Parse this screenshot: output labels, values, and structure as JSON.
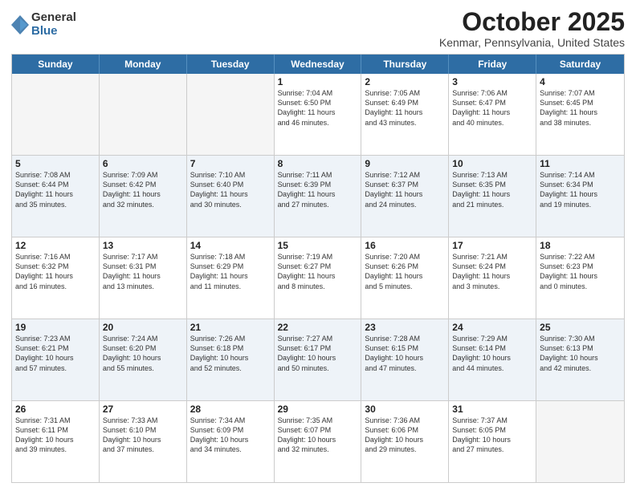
{
  "logo": {
    "general": "General",
    "blue": "Blue"
  },
  "header": {
    "month": "October 2025",
    "location": "Kenmar, Pennsylvania, United States"
  },
  "weekdays": [
    "Sunday",
    "Monday",
    "Tuesday",
    "Wednesday",
    "Thursday",
    "Friday",
    "Saturday"
  ],
  "rows": [
    [
      {
        "day": "",
        "info": "",
        "empty": true
      },
      {
        "day": "",
        "info": "",
        "empty": true
      },
      {
        "day": "",
        "info": "",
        "empty": true
      },
      {
        "day": "1",
        "info": "Sunrise: 7:04 AM\nSunset: 6:50 PM\nDaylight: 11 hours\nand 46 minutes."
      },
      {
        "day": "2",
        "info": "Sunrise: 7:05 AM\nSunset: 6:49 PM\nDaylight: 11 hours\nand 43 minutes."
      },
      {
        "day": "3",
        "info": "Sunrise: 7:06 AM\nSunset: 6:47 PM\nDaylight: 11 hours\nand 40 minutes."
      },
      {
        "day": "4",
        "info": "Sunrise: 7:07 AM\nSunset: 6:45 PM\nDaylight: 11 hours\nand 38 minutes."
      }
    ],
    [
      {
        "day": "5",
        "info": "Sunrise: 7:08 AM\nSunset: 6:44 PM\nDaylight: 11 hours\nand 35 minutes."
      },
      {
        "day": "6",
        "info": "Sunrise: 7:09 AM\nSunset: 6:42 PM\nDaylight: 11 hours\nand 32 minutes."
      },
      {
        "day": "7",
        "info": "Sunrise: 7:10 AM\nSunset: 6:40 PM\nDaylight: 11 hours\nand 30 minutes."
      },
      {
        "day": "8",
        "info": "Sunrise: 7:11 AM\nSunset: 6:39 PM\nDaylight: 11 hours\nand 27 minutes."
      },
      {
        "day": "9",
        "info": "Sunrise: 7:12 AM\nSunset: 6:37 PM\nDaylight: 11 hours\nand 24 minutes."
      },
      {
        "day": "10",
        "info": "Sunrise: 7:13 AM\nSunset: 6:35 PM\nDaylight: 11 hours\nand 21 minutes."
      },
      {
        "day": "11",
        "info": "Sunrise: 7:14 AM\nSunset: 6:34 PM\nDaylight: 11 hours\nand 19 minutes."
      }
    ],
    [
      {
        "day": "12",
        "info": "Sunrise: 7:16 AM\nSunset: 6:32 PM\nDaylight: 11 hours\nand 16 minutes."
      },
      {
        "day": "13",
        "info": "Sunrise: 7:17 AM\nSunset: 6:31 PM\nDaylight: 11 hours\nand 13 minutes."
      },
      {
        "day": "14",
        "info": "Sunrise: 7:18 AM\nSunset: 6:29 PM\nDaylight: 11 hours\nand 11 minutes."
      },
      {
        "day": "15",
        "info": "Sunrise: 7:19 AM\nSunset: 6:27 PM\nDaylight: 11 hours\nand 8 minutes."
      },
      {
        "day": "16",
        "info": "Sunrise: 7:20 AM\nSunset: 6:26 PM\nDaylight: 11 hours\nand 5 minutes."
      },
      {
        "day": "17",
        "info": "Sunrise: 7:21 AM\nSunset: 6:24 PM\nDaylight: 11 hours\nand 3 minutes."
      },
      {
        "day": "18",
        "info": "Sunrise: 7:22 AM\nSunset: 6:23 PM\nDaylight: 11 hours\nand 0 minutes."
      }
    ],
    [
      {
        "day": "19",
        "info": "Sunrise: 7:23 AM\nSunset: 6:21 PM\nDaylight: 10 hours\nand 57 minutes."
      },
      {
        "day": "20",
        "info": "Sunrise: 7:24 AM\nSunset: 6:20 PM\nDaylight: 10 hours\nand 55 minutes."
      },
      {
        "day": "21",
        "info": "Sunrise: 7:26 AM\nSunset: 6:18 PM\nDaylight: 10 hours\nand 52 minutes."
      },
      {
        "day": "22",
        "info": "Sunrise: 7:27 AM\nSunset: 6:17 PM\nDaylight: 10 hours\nand 50 minutes."
      },
      {
        "day": "23",
        "info": "Sunrise: 7:28 AM\nSunset: 6:15 PM\nDaylight: 10 hours\nand 47 minutes."
      },
      {
        "day": "24",
        "info": "Sunrise: 7:29 AM\nSunset: 6:14 PM\nDaylight: 10 hours\nand 44 minutes."
      },
      {
        "day": "25",
        "info": "Sunrise: 7:30 AM\nSunset: 6:13 PM\nDaylight: 10 hours\nand 42 minutes."
      }
    ],
    [
      {
        "day": "26",
        "info": "Sunrise: 7:31 AM\nSunset: 6:11 PM\nDaylight: 10 hours\nand 39 minutes."
      },
      {
        "day": "27",
        "info": "Sunrise: 7:33 AM\nSunset: 6:10 PM\nDaylight: 10 hours\nand 37 minutes."
      },
      {
        "day": "28",
        "info": "Sunrise: 7:34 AM\nSunset: 6:09 PM\nDaylight: 10 hours\nand 34 minutes."
      },
      {
        "day": "29",
        "info": "Sunrise: 7:35 AM\nSunset: 6:07 PM\nDaylight: 10 hours\nand 32 minutes."
      },
      {
        "day": "30",
        "info": "Sunrise: 7:36 AM\nSunset: 6:06 PM\nDaylight: 10 hours\nand 29 minutes."
      },
      {
        "day": "31",
        "info": "Sunrise: 7:37 AM\nSunset: 6:05 PM\nDaylight: 10 hours\nand 27 minutes."
      },
      {
        "day": "",
        "info": "",
        "empty": true
      }
    ]
  ]
}
